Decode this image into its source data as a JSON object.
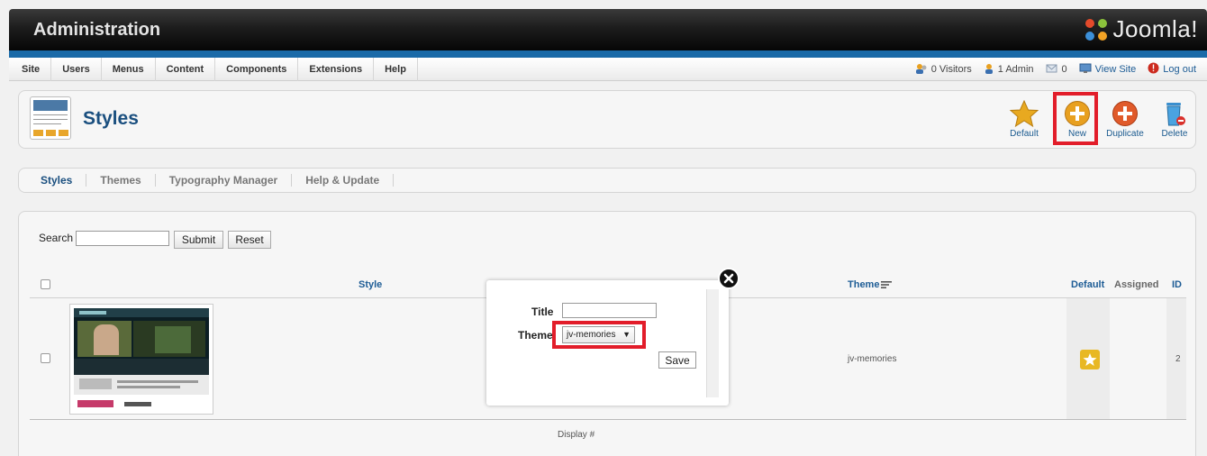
{
  "header": {
    "title": "Administration",
    "logo_text": "Joomla!"
  },
  "menu": {
    "items": [
      "Site",
      "Users",
      "Menus",
      "Content",
      "Components",
      "Extensions",
      "Help"
    ]
  },
  "status": {
    "visitors": "0 Visitors",
    "admin": "1 Admin",
    "messages": "0",
    "view_site": "View Site",
    "logout": "Log out"
  },
  "toolbar": {
    "page_title": "Styles",
    "buttons": {
      "default": "Default",
      "new": "New",
      "duplicate": "Duplicate",
      "delete": "Delete"
    },
    "colors": {
      "highlight": "#e21d2a",
      "new_icon": "#e8a020",
      "duplicate_icon": "#e05a2a"
    }
  },
  "tabs": [
    "Styles",
    "Themes",
    "Typography Manager",
    "Help & Update"
  ],
  "filter": {
    "search_label": "Search",
    "search_value": "",
    "submit_label": "Submit",
    "reset_label": "Reset"
  },
  "table": {
    "columns": {
      "style": "Style",
      "theme": "Theme",
      "default": "Default",
      "assigned": "Assigned",
      "id": "ID"
    },
    "rows": [
      {
        "theme": "jv-memories",
        "id": "2"
      }
    ],
    "display_label": "Display #"
  },
  "modal": {
    "title_label": "Title",
    "title_value": "",
    "theme_label": "Theme",
    "theme_selected": "jv-memories",
    "save_label": "Save"
  }
}
